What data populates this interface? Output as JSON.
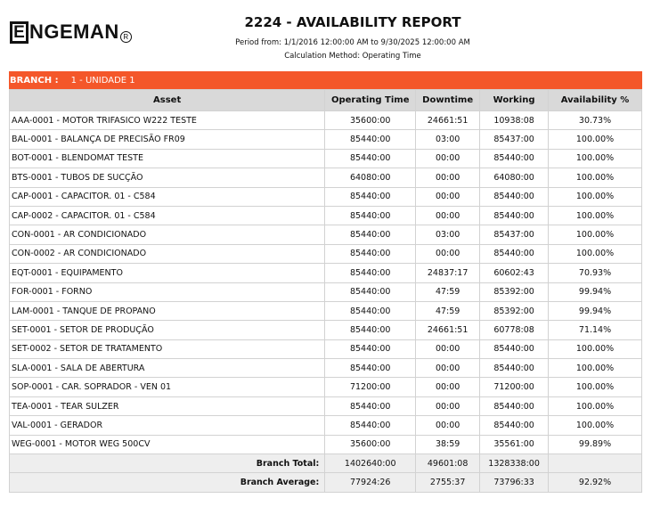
{
  "logo": {
    "box_letter": "E",
    "text": "NGEMAN",
    "reg": "R"
  },
  "report": {
    "title": "2224 - AVAILABILITY REPORT",
    "period": "Period from: 1/1/2016 12:00:00 AM  to  9/30/2025 12:00:00 AM",
    "calc_method": "Calculation Method: Operating Time"
  },
  "branch": {
    "label": "BRANCH :",
    "value": "1 - UNIDADE 1",
    "color": "#f4572a"
  },
  "table": {
    "headers": [
      "Asset",
      "Operating Time",
      "Downtime",
      "Working",
      "Availability  %"
    ],
    "rows": [
      [
        "AAA-0001 - MOTOR TRIFASICO W222 TESTE",
        "35600:00",
        "24661:51",
        "10938:08",
        "30.73%"
      ],
      [
        "BAL-0001 - BALANÇA DE PRECISÃO FR09",
        "85440:00",
        "03:00",
        "85437:00",
        "100.00%"
      ],
      [
        "BOT-0001 - BLENDOMAT TESTE",
        "85440:00",
        "00:00",
        "85440:00",
        "100.00%"
      ],
      [
        "BTS-0001 - TUBOS DE SUCÇÃO",
        "64080:00",
        "00:00",
        "64080:00",
        "100.00%"
      ],
      [
        "CAP-0001 - CAPACITOR. 01 - C584",
        "85440:00",
        "00:00",
        "85440:00",
        "100.00%"
      ],
      [
        "CAP-0002 - CAPACITOR. 01 - C584",
        "85440:00",
        "00:00",
        "85440:00",
        "100.00%"
      ],
      [
        "CON-0001 - AR CONDICIONADO",
        "85440:00",
        "03:00",
        "85437:00",
        "100.00%"
      ],
      [
        "CON-0002 - AR CONDICIONADO",
        "85440:00",
        "00:00",
        "85440:00",
        "100.00%"
      ],
      [
        "EQT-0001 - EQUIPAMENTO",
        "85440:00",
        "24837:17",
        "60602:43",
        "70.93%"
      ],
      [
        "FOR-0001 - FORNO",
        "85440:00",
        "47:59",
        "85392:00",
        "99.94%"
      ],
      [
        "LAM-0001 - TANQUE DE PROPANO",
        "85440:00",
        "47:59",
        "85392:00",
        "99.94%"
      ],
      [
        "SET-0001 - SETOR DE PRODUÇÃO",
        "85440:00",
        "24661:51",
        "60778:08",
        "71.14%"
      ],
      [
        "SET-0002 - SETOR DE TRATAMENTO",
        "85440:00",
        "00:00",
        "85440:00",
        "100.00%"
      ],
      [
        "SLA-0001 - SALA DE ABERTURA",
        "85440:00",
        "00:00",
        "85440:00",
        "100.00%"
      ],
      [
        "SOP-0001 - CAR. SOPRADOR - VEN 01",
        "71200:00",
        "00:00",
        "71200:00",
        "100.00%"
      ],
      [
        "TEA-0001 - TEAR SULZER",
        "85440:00",
        "00:00",
        "85440:00",
        "100.00%"
      ],
      [
        "VAL-0001 - GERADOR",
        "85440:00",
        "00:00",
        "85440:00",
        "100.00%"
      ],
      [
        "WEG-0001 - MOTOR WEG 500CV",
        "35600:00",
        "38:59",
        "35561:00",
        "99.89%"
      ]
    ],
    "totals": [
      [
        "Branch Total:",
        "1402640:00",
        "49601:08",
        "1328338:00",
        ""
      ],
      [
        "Branch Average:",
        "77924:26",
        "2755:37",
        "73796:33",
        "92.92%"
      ]
    ]
  }
}
